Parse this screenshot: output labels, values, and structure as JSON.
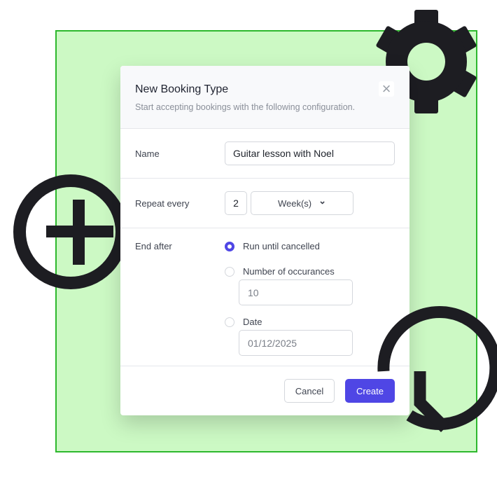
{
  "dialog": {
    "title": "New Booking Type",
    "subtitle": "Start accepting bookings with the following configuration.",
    "close_icon": "×",
    "name": {
      "label": "Name",
      "value": "Guitar lesson with Noel"
    },
    "repeat": {
      "label": "Repeat every",
      "count": "2",
      "unit": "Week(s)",
      "chevron": "⌄"
    },
    "end_after": {
      "label": "End after",
      "options": [
        {
          "label": "Run until cancelled",
          "selected": true
        },
        {
          "label": "Number of occurances",
          "selected": false,
          "value": "10"
        },
        {
          "label": "Date",
          "selected": false,
          "value": "01/12/2025"
        }
      ]
    },
    "cancel_label": "Cancel",
    "create_label": "Create"
  },
  "colors": {
    "accent": "#4f46e5",
    "background_green": "#ccf9c4",
    "border_green": "#2db82d",
    "icon_dark": "#1d1d22"
  }
}
